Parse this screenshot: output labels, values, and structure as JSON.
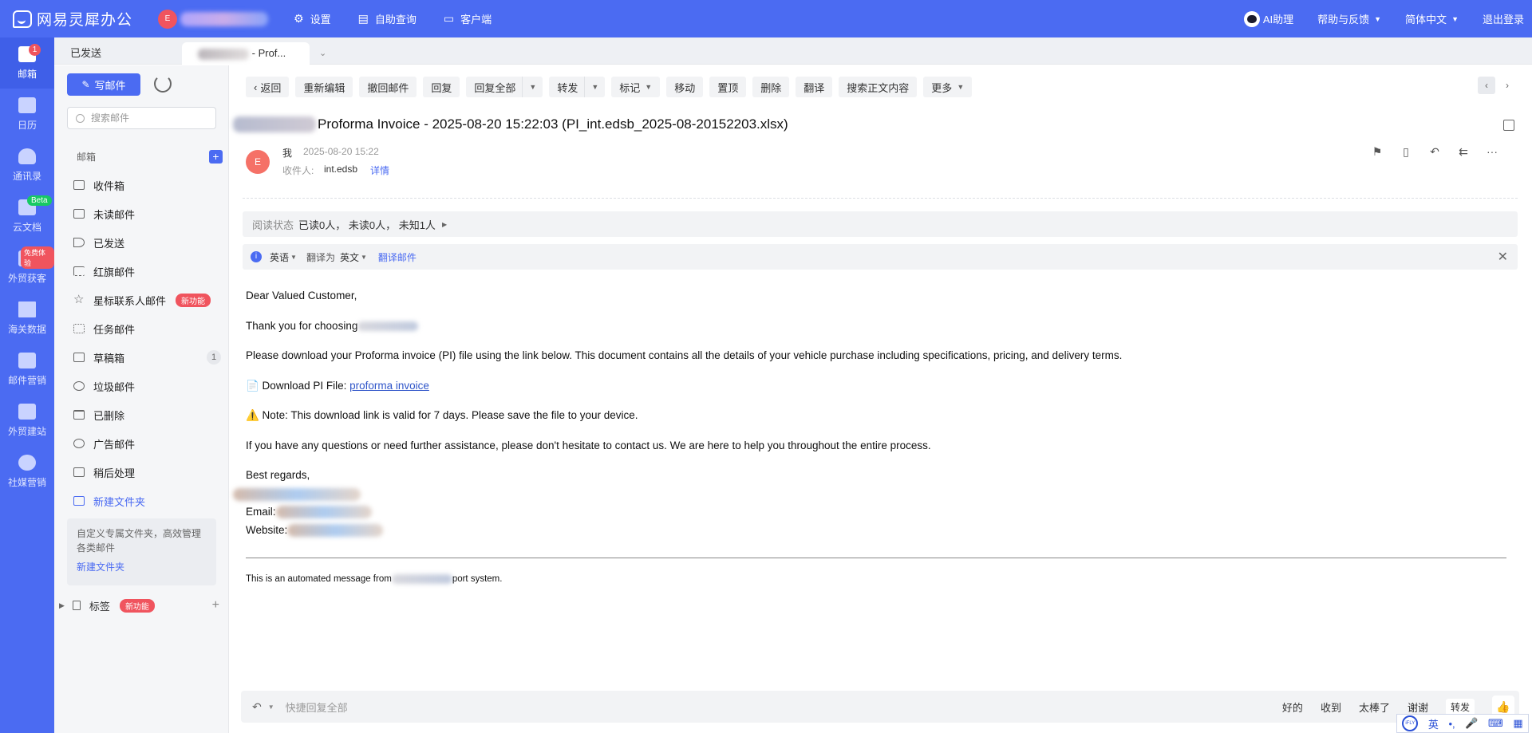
{
  "topbar": {
    "brand": "网易灵犀办公",
    "avatar_letter": "E",
    "nav": [
      {
        "label": "设置",
        "icon": "gear-icon"
      },
      {
        "label": "自助查询",
        "icon": "document-search-icon"
      },
      {
        "label": "客户端",
        "icon": "chat-icon"
      }
    ],
    "ai_label": "AI助理",
    "help_label": "帮助与反馈",
    "lang_label": "简体中文",
    "logout_label": "退出登录"
  },
  "rail": {
    "apps": [
      {
        "label": "邮箱",
        "badge": "1"
      },
      {
        "label": "日历",
        "badge": ""
      },
      {
        "label": "通讯录",
        "badge": ""
      },
      {
        "label": "云文档",
        "badge": "Beta"
      },
      {
        "label": "外贸获客",
        "badge": "免费体验"
      },
      {
        "label": "海关数据",
        "badge": ""
      },
      {
        "label": "邮件营销",
        "badge": ""
      },
      {
        "label": "外贸建站",
        "badge": ""
      },
      {
        "label": "社媒营销",
        "badge": ""
      }
    ]
  },
  "tabs": {
    "sent": "已发送",
    "current_suffix": "- Prof...",
    "more": "⌄"
  },
  "sidebar": {
    "compose": "写邮件",
    "search_placeholder": "搜索邮件",
    "mailbox_header": "邮箱",
    "folders": [
      {
        "label": "收件箱",
        "tag": "",
        "count": ""
      },
      {
        "label": "未读邮件",
        "tag": "",
        "count": ""
      },
      {
        "label": "已发送",
        "tag": "",
        "count": ""
      },
      {
        "label": "红旗邮件",
        "tag": "",
        "count": ""
      },
      {
        "label": "星标联系人邮件",
        "tag": "新功能",
        "count": ""
      },
      {
        "label": "任务邮件",
        "tag": "",
        "count": ""
      },
      {
        "label": "草稿箱",
        "tag": "",
        "count": "1"
      },
      {
        "label": "垃圾邮件",
        "tag": "",
        "count": ""
      },
      {
        "label": "已删除",
        "tag": "",
        "count": ""
      },
      {
        "label": "广告邮件",
        "tag": "",
        "count": ""
      },
      {
        "label": "稍后处理",
        "tag": "",
        "count": ""
      },
      {
        "label": "新建文件夹",
        "tag": "",
        "count": ""
      }
    ],
    "tip_text": "自定义专属文件夹，高效管理各类邮件",
    "tip_link": "新建文件夹",
    "tags_label": "标签",
    "tags_badge": "新功能"
  },
  "toolbar": {
    "buttons": [
      "返回",
      "重新编辑",
      "撤回邮件",
      "回复",
      "回复全部",
      "转发",
      "标记",
      "移动",
      "置顶",
      "删除",
      "翻译",
      "搜索正文内容",
      "更多"
    ]
  },
  "message": {
    "subject": "Proforma Invoice - 2025-08-20 15:22:03 (PI_int.edsb_2025-08-20152203.xlsx)",
    "sender_avatar": "E",
    "sender": "我",
    "date": "2025-08-20 15:22",
    "recipient_label": "收件人:",
    "recipient": "int.edsb",
    "details_link": "详情"
  },
  "read_status": {
    "label": "阅读状态",
    "value": "已读0人， 未读0人， 未知1人"
  },
  "translate": {
    "source": "英语",
    "to_label": "翻译为",
    "target": "英文",
    "action": "翻译邮件"
  },
  "body": {
    "greeting": "Dear Valued Customer,",
    "thanks": "Thank you for choosing",
    "instruction": "Please download your Proforma invoice (PI) file using the link below. This document contains all the details of your vehicle purchase including specifications, pricing, and delivery terms.",
    "download_prefix": "📄 Download PI File: ",
    "download_link": "proforma invoice",
    "note": "⚠️ Note: This download link is valid for 7 days. Please save the file to your device.",
    "contact": "If you have any questions or need further assistance, please don't hesitate to contact us. We are here to help you throughout the entire process.",
    "regards": "Best regards,",
    "email_label": "Email:",
    "website_label": "Website:",
    "footer_prefix": "This is an automated message from",
    "footer_suffix": "port system."
  },
  "reply_bar": {
    "placeholder": "快捷回复全部",
    "quick": [
      "好的",
      "收到",
      "太棒了",
      "谢谢"
    ],
    "forward": "转发"
  },
  "ime": {
    "logo": "iFLY",
    "lang": "英"
  }
}
